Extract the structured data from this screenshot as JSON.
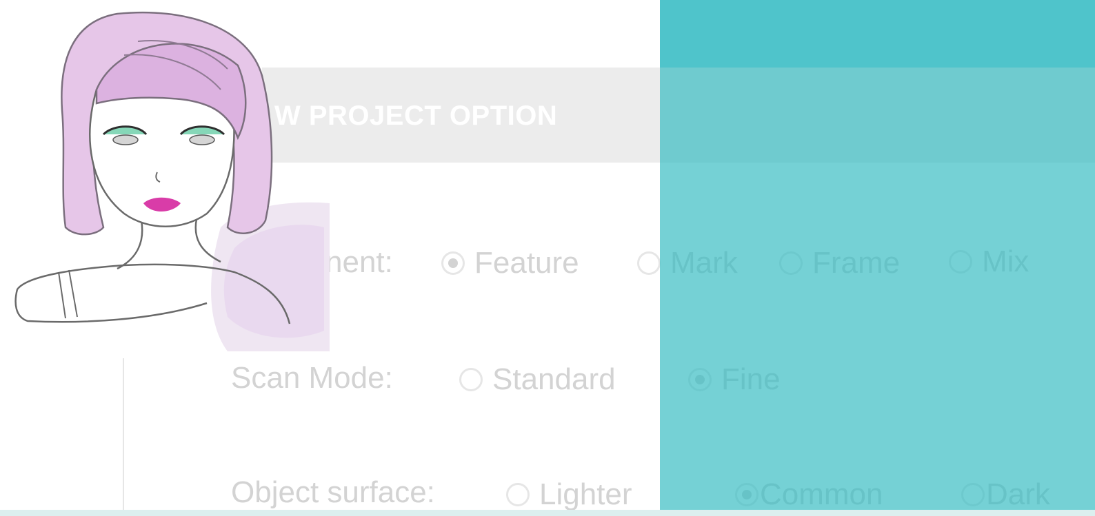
{
  "header": {
    "title": "W PROJECT OPTION"
  },
  "rows": [
    {
      "label": "nent:",
      "options": [
        {
          "label": "Feature",
          "checked": true
        },
        {
          "label": "Mark",
          "checked": false
        },
        {
          "label": "Frame",
          "checked": false
        },
        {
          "label": "Mix",
          "checked": false
        }
      ]
    },
    {
      "label": "Scan Mode:",
      "options": [
        {
          "label": "Standard",
          "checked": false
        },
        {
          "label": "Fine",
          "checked": true
        }
      ]
    },
    {
      "label": "Object surface:",
      "options": [
        {
          "label": "Lighter",
          "checked": false
        },
        {
          "label": "Common",
          "checked": true
        },
        {
          "label": "Dark",
          "checked": false
        }
      ]
    }
  ],
  "colors": {
    "teal_overlay": "#34bbc1",
    "teal_top": "#4fc4cb",
    "header_band": "#ececec",
    "option_text": "#d3d3d3",
    "hair": "#e5c8e8",
    "lips": "#d93ca8",
    "eyeshadow": "#86d7b8"
  },
  "illustration": {
    "icon": "woman-avatar-icon"
  }
}
